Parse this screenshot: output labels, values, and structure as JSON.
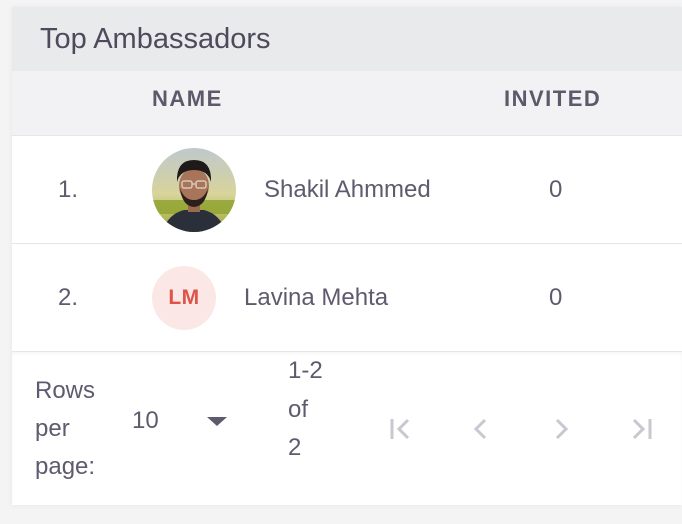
{
  "card": {
    "title": "Top Ambassadors"
  },
  "table": {
    "columns": {
      "name": "NAME",
      "invited": "INVITED"
    },
    "rows": [
      {
        "rank": "1.",
        "name": "Shakil Ahmmed",
        "invited": "0",
        "avatar": "photo"
      },
      {
        "rank": "2.",
        "name": "Lavina Mehta",
        "invited": "0",
        "initials": "LM"
      }
    ]
  },
  "pagination": {
    "rows_per_page_label": "Rows per page:",
    "rows_per_page_value": "10",
    "range_text": "1-2 of 2",
    "buttons": [
      "first-page-icon",
      "previous-page-icon",
      "next-page-icon",
      "last-page-icon"
    ]
  },
  "colors": {
    "header_bg": "#e9eaec",
    "thead_bg": "#f2f2f5",
    "initials_bg": "#fbe8e6",
    "initials_text": "#e0524a",
    "disabled_icon": "#c9c7cf"
  }
}
